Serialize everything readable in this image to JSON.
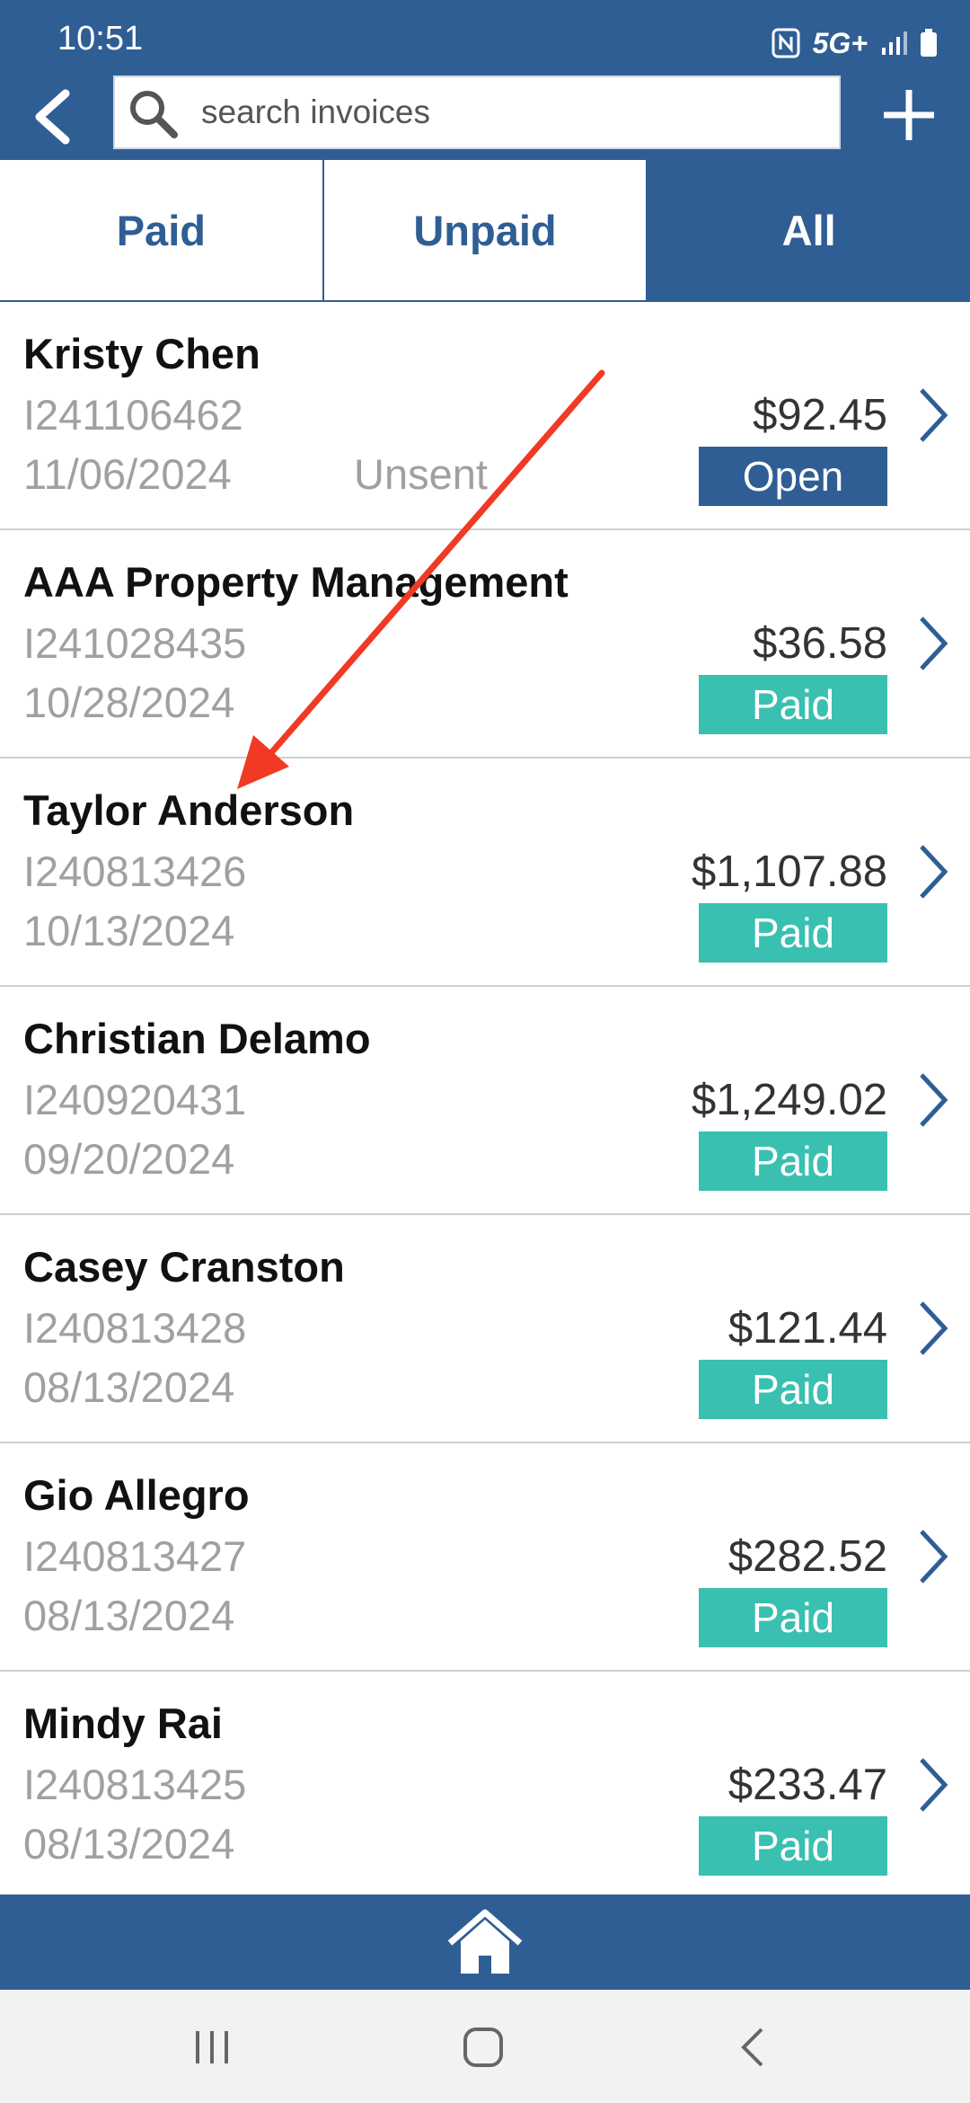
{
  "status_bar": {
    "time": "10:51",
    "network": "5G+"
  },
  "search": {
    "placeholder": "search invoices",
    "value": ""
  },
  "tabs": [
    {
      "label": "Paid",
      "active": false
    },
    {
      "label": "Unpaid",
      "active": false
    },
    {
      "label": "All",
      "active": true
    }
  ],
  "invoices": [
    {
      "name": "Kristy Chen",
      "number": "I241106462",
      "date": "11/06/2024",
      "sent_status": "Unsent",
      "amount": "$92.45",
      "status": "Open"
    },
    {
      "name": "AAA Property Management",
      "number": "I241028435",
      "date": "10/28/2024",
      "sent_status": "",
      "amount": "$36.58",
      "status": "Paid"
    },
    {
      "name": "Taylor Anderson",
      "number": "I240813426",
      "date": "10/13/2024",
      "sent_status": "",
      "amount": "$1,107.88",
      "status": "Paid"
    },
    {
      "name": "Christian Delamo",
      "number": "I240920431",
      "date": "09/20/2024",
      "sent_status": "",
      "amount": "$1,249.02",
      "status": "Paid"
    },
    {
      "name": "Casey Cranston",
      "number": "I240813428",
      "date": "08/13/2024",
      "sent_status": "",
      "amount": "$121.44",
      "status": "Paid"
    },
    {
      "name": "Gio Allegro",
      "number": "I240813427",
      "date": "08/13/2024",
      "sent_status": "",
      "amount": "$282.52",
      "status": "Paid"
    },
    {
      "name": "Mindy Rai",
      "number": "I240813425",
      "date": "08/13/2024",
      "sent_status": "",
      "amount": "$233.47",
      "status": "Paid"
    }
  ],
  "colors": {
    "brand": "#2f5e94",
    "paid": "#39c0b1",
    "open": "#2f5e94",
    "annotation_arrow": "#f03a24"
  },
  "icons": {
    "back": "back-arrow-icon",
    "search": "search-icon",
    "add": "plus-icon",
    "row": "chevron-right-icon",
    "home": "home-icon"
  }
}
